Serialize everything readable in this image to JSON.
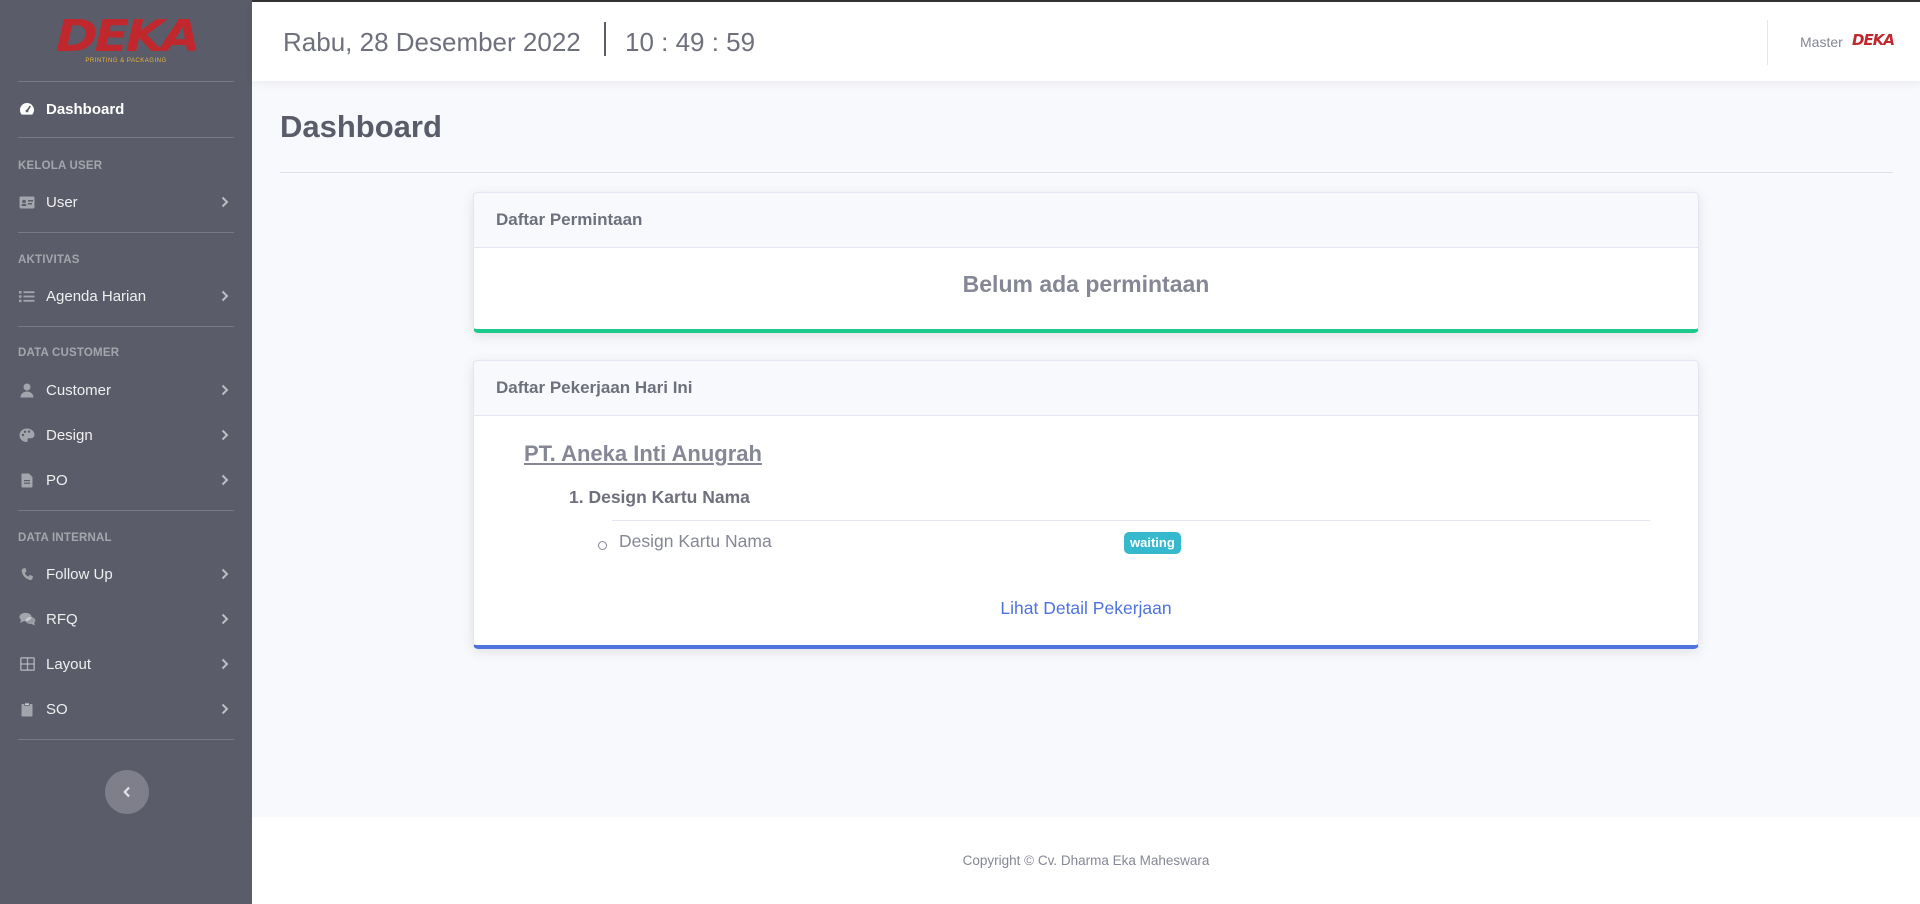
{
  "brand": {
    "logo_text": "DEKA",
    "tagline": "PRINTING & PACKAGING"
  },
  "sidebar": {
    "dashboard": "Dashboard",
    "headings": [
      "KELOLA USER",
      "AKTIVITAS",
      "DATA CUSTOMER",
      "DATA INTERNAL"
    ],
    "items": {
      "user": "User",
      "agenda": "Agenda Harian",
      "customer": "Customer",
      "design": "Design",
      "po": "PO",
      "followup": "Follow Up",
      "rfq": "RFQ",
      "layout": "Layout",
      "so": "SO"
    }
  },
  "topbar": {
    "date": "Rabu, 28 Desember 2022",
    "time": "10 : 49 : 59",
    "user_name": "Master",
    "user_logo": "DEKA"
  },
  "main": {
    "title": "Dashboard",
    "requests_card": {
      "title": "Daftar Permintaan",
      "empty_text": "Belum ada permintaan"
    },
    "jobs_card": {
      "title": "Daftar Pekerjaan Hari Ini",
      "company": "PT. Aneka Inti Anugrah",
      "job": "1. Design Kartu Nama",
      "task": "Design Kartu Nama",
      "status": "waiting",
      "link": "Lihat Detail Pekerjaan"
    }
  },
  "footer": {
    "copyright": "Copyright © Cv. Dharma Eka Maheswara"
  },
  "colors": {
    "sidebar": "#5a5c69",
    "success": "#1cc88a",
    "primary": "#4e73df",
    "info": "#36b9cc",
    "brand": "#c0282d"
  }
}
